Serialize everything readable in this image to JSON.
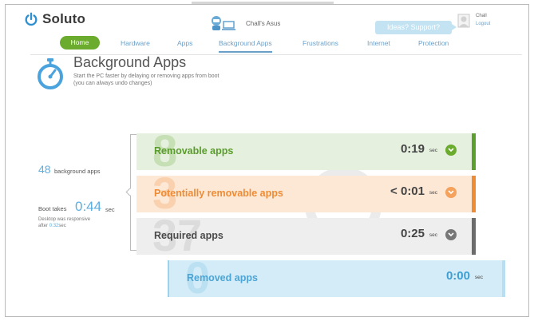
{
  "app": {
    "logo_text": "Soluto",
    "computer_name": "Chall's Asus",
    "support_label": "Ideas? Support?",
    "user_name": "Chall",
    "logout_label": "Logout"
  },
  "nav": {
    "items": [
      {
        "label": "Home"
      },
      {
        "label": "Hardware"
      },
      {
        "label": "Apps"
      },
      {
        "label": "Background Apps"
      },
      {
        "label": "Frustrations"
      },
      {
        "label": "Internet"
      },
      {
        "label": "Protection"
      }
    ],
    "active": "Background Apps"
  },
  "page": {
    "title": "Background Apps",
    "subtitle_line1": "Start the PC faster by delaying or removing apps from boot",
    "subtitle_line2": "(you can always undo changes)"
  },
  "stats": {
    "background_count": "48",
    "background_label": "background apps",
    "boot_label": "Boot takes",
    "boot_time": "0:44",
    "boot_unit": "sec",
    "desktop_line1": "Desktop was responsive",
    "desktop_line2_prefix": "after",
    "desktop_time": "0:32",
    "desktop_unit": "sec"
  },
  "bars": {
    "removable": {
      "count": "8",
      "label": "Removable apps",
      "time": "0:19",
      "unit": "sec"
    },
    "potential": {
      "count": "3",
      "label": "Potentially removable apps",
      "time": "< 0:01",
      "unit": "sec"
    },
    "required": {
      "count": "37",
      "label": "Required apps",
      "time": "0:25",
      "unit": "sec"
    },
    "removed": {
      "count": "0",
      "label": "Removed apps",
      "time": "0:00",
      "unit": "sec"
    }
  },
  "colors": {
    "accent_blue": "#5eaee0",
    "green": "#6bab2d",
    "orange": "#ee8c35",
    "gray": "#6b6b6b"
  },
  "icons": {
    "logo": "power-icon",
    "computer": "robot-computer-icon",
    "user": "user-avatar-icon",
    "page": "stopwatch-icon",
    "chevron": "chevron-down-icon"
  }
}
